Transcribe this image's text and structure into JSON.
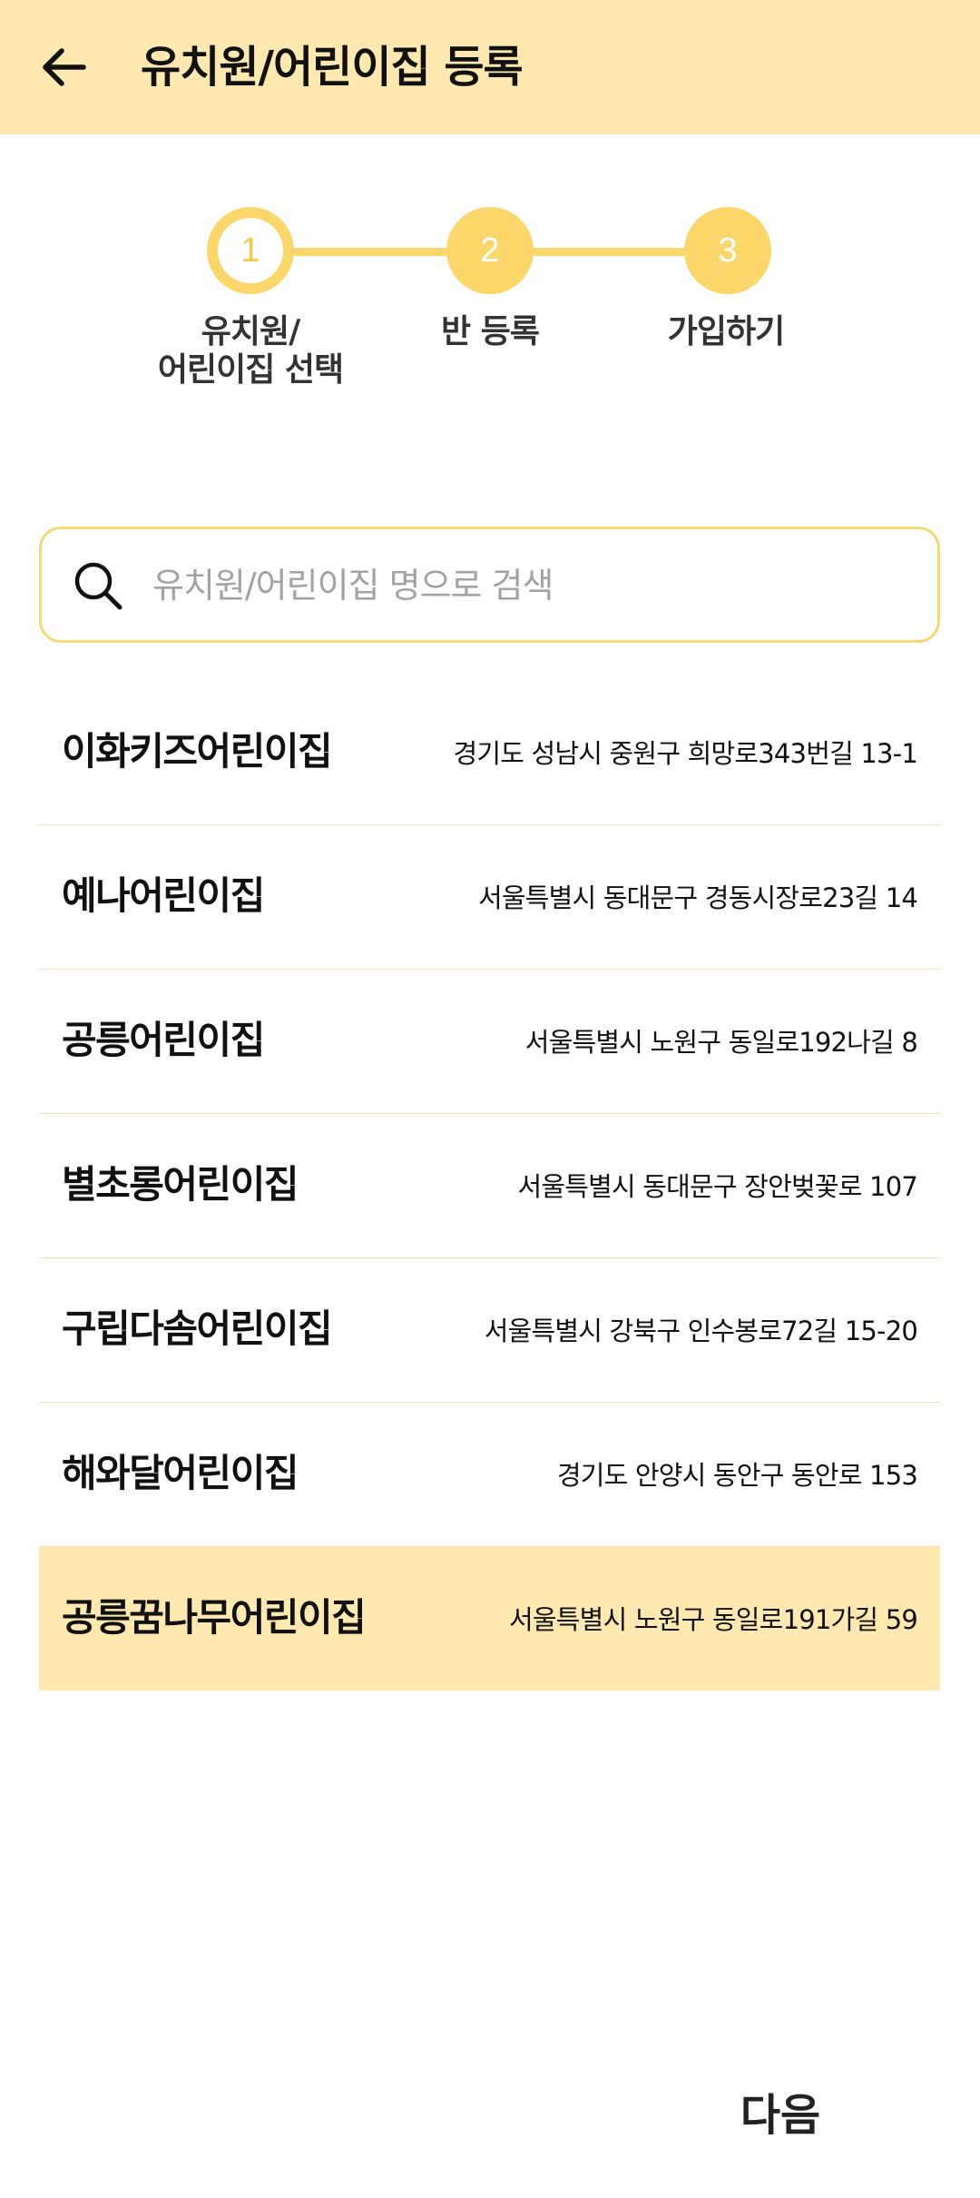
{
  "header": {
    "back_icon": "arrow-left-icon",
    "title": "유치원/어린이집 등록",
    "background": "#FFE9B0"
  },
  "stepper": {
    "accent": "#FBD66B",
    "current_step": 1,
    "steps": [
      {
        "number": "1",
        "label": "유치원/\n어린이집 선택"
      },
      {
        "number": "2",
        "label": "반 등록"
      },
      {
        "number": "3",
        "label": "가입하기"
      }
    ]
  },
  "search": {
    "icon": "search-icon",
    "placeholder": "유치원/어린이집 명으로 검색",
    "value": ""
  },
  "list": {
    "selected_index": 6,
    "items": [
      {
        "name": "이화키즈어린이집",
        "address": "경기도 성남시 중원구 희망로343번길 13-1"
      },
      {
        "name": "예나어린이집",
        "address": "서울특별시 동대문구 경동시장로23길 14"
      },
      {
        "name": "공릉어린이집",
        "address": "서울특별시 노원구 동일로192나길 8"
      },
      {
        "name": "별초롱어린이집",
        "address": "서울특별시 동대문구 장안벚꽃로 107"
      },
      {
        "name": "구립다솜어린이집",
        "address": "서울특별시 강북구 인수봉로72길 15-20"
      },
      {
        "name": "해와달어린이집",
        "address": "경기도 안양시 동안구 동안로 153"
      },
      {
        "name": "공릉꿈나무어린이집",
        "address": "서울특별시 노원구 동일로191가길 59"
      }
    ]
  },
  "footer": {
    "next_label": "다음"
  }
}
